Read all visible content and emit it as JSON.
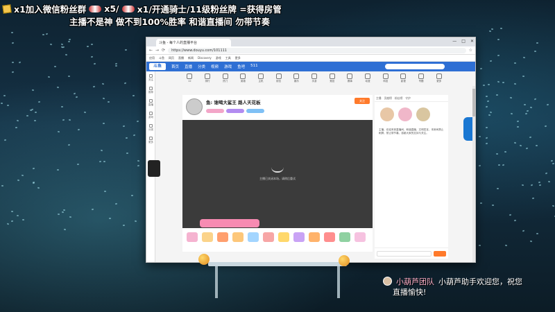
{
  "overlay": {
    "line1": "x1加入微信粉丝群",
    "line1b": "x5/",
    "line1c": "x1/开通骑士/11级粉丝牌 =获得房管",
    "line2": "主播不是神 做不到100%胜率 和谐直播间 勿带节奏"
  },
  "browser": {
    "tab_title": "斗鱼 - 每个人的直播平台",
    "url": "https://www.douyu.com/101111",
    "bookmarks": [
      "应用",
      "斗鱼",
      "网页",
      "直播",
      "新闻",
      "Discovery",
      "游戏",
      "工具",
      "更多"
    ]
  },
  "site": {
    "logo": "斗鱼",
    "nav": [
      "首页",
      "直播",
      "分类",
      "视频",
      "游戏",
      "鱼吧",
      "511"
    ],
    "sidebar": [
      "关注",
      "推荐",
      "直播",
      "游戏",
      "分类",
      "更多"
    ],
    "categories": [
      "12",
      "排行",
      "热门",
      "英雄",
      "主机",
      "射击",
      "娱乐",
      "手游",
      "竞技",
      "赛事",
      "动漫",
      "科技",
      "影视",
      "专题",
      "更多"
    ],
    "room_title": "鱼: 谁喝大鲨王 路人天花板",
    "follow_label": "关注",
    "player_message": "主播已关闭本场，请稍后重试",
    "right_tabs": [
      "主播",
      "贡献榜",
      "粉丝榜",
      "守护"
    ],
    "right_text": "主播，欢迎来到直播间，和谐直播，文明发言，本房间禁止刷屏，禁止带节奏，感谢大家的支持与关注。"
  },
  "notice": {
    "sender": "小葫芦团队",
    "text": "小葫芦助手欢迎您，祝您",
    "text2": "直播愉快!"
  }
}
